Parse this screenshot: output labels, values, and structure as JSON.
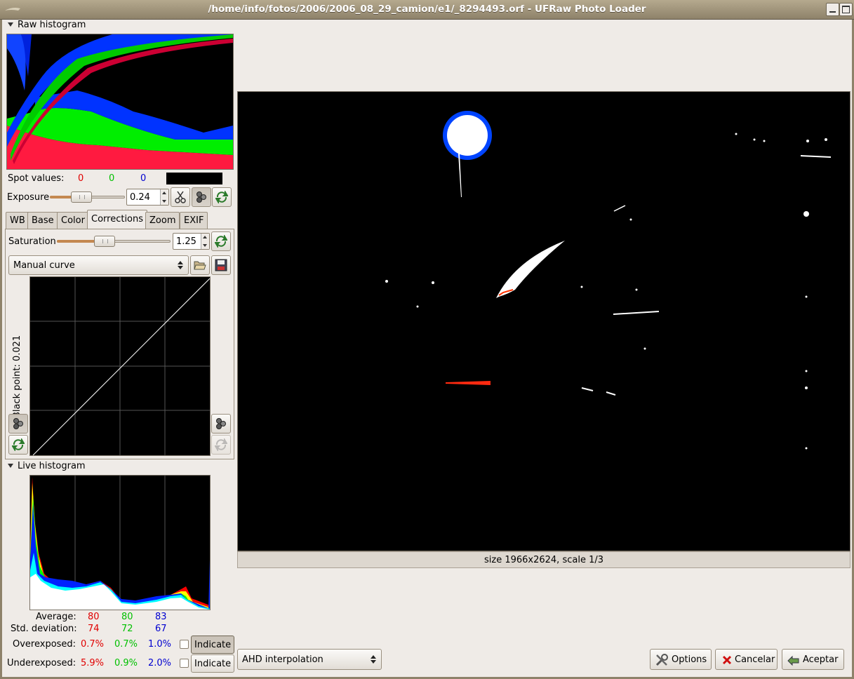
{
  "window": {
    "title": "/home/info/fotos/2006/2006_08_29_camion/e1/_8294493.orf - UFRaw Photo Loader"
  },
  "raw_histogram": {
    "label": "Raw histogram",
    "spot_label": "Spot values:",
    "spot_r": "0",
    "spot_g": "0",
    "spot_b": "0",
    "spot_color": "#000000"
  },
  "exposure": {
    "label": "Exposure",
    "value": "0.24",
    "level": 0.42
  },
  "tabs": [
    {
      "label": "WB"
    },
    {
      "label": "Base"
    },
    {
      "label": "Color"
    },
    {
      "label": "Corrections"
    },
    {
      "label": "Zoom"
    },
    {
      "label": "EXIF"
    }
  ],
  "active_tab": "Corrections",
  "corrections": {
    "saturation_label": "Saturation",
    "saturation_value": "1.25",
    "saturation_level": 0.42,
    "curve_select": "Manual curve",
    "black_point_label": "Black point: 0.021"
  },
  "live_histogram": {
    "label": "Live histogram",
    "average_label": "Average:",
    "average": [
      "80",
      "80",
      "83"
    ],
    "std_label": "Std. deviation:",
    "std": [
      "74",
      "72",
      "67"
    ],
    "over_label": "Overexposed:",
    "over": [
      "0.7%",
      "0.7%",
      "1.0%"
    ],
    "under_label": "Underexposed:",
    "under": [
      "5.9%",
      "0.9%",
      "2.0%"
    ],
    "indicate_over": "Indicate",
    "indicate_under": "Indicate"
  },
  "preview": {
    "status": "size 1966x2624, scale 1/3"
  },
  "bottom": {
    "interpolation": "AHD interpolation",
    "options": "Options",
    "cancel": "Cancelar",
    "accept": "Aceptar"
  },
  "colors": {
    "red": "#e00000",
    "green": "#00c000",
    "blue": "#0000d0"
  }
}
